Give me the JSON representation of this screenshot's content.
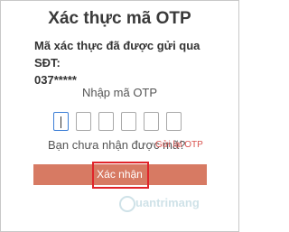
{
  "dialog": {
    "title": "Xác thực mã OTP",
    "description_line1": "Mã xác thực đã được gửi qua SĐT:",
    "phone_masked": "037*****",
    "otp_label": "Nhập mã OTP",
    "otp_boxes": 6,
    "not_received": "Bạn chưa nhận được mã?",
    "resend_link": "Gửi lại OTP",
    "confirm_button": "Xác nhận"
  },
  "watermark": {
    "text": "uantrimang",
    "icon": "quantrimang-logo-icon"
  },
  "colors": {
    "button": "#d77a63",
    "highlight_border": "#e0242a",
    "resend_link": "#d9534f",
    "active_box": "#3d7fd6"
  }
}
